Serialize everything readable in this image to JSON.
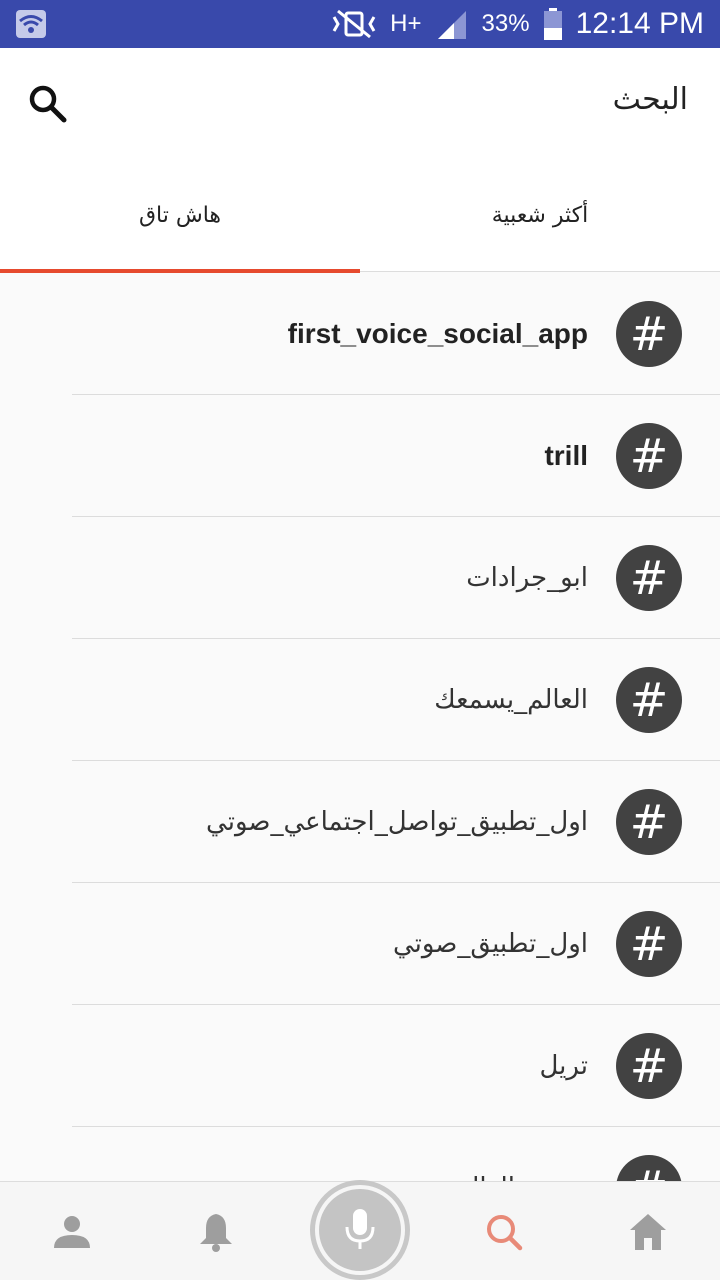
{
  "status_bar": {
    "network": "H+",
    "battery": "33%",
    "time": "12:14 PM"
  },
  "header": {
    "title": "البحث"
  },
  "tabs": [
    {
      "label": "أكثر شعبية",
      "active": false
    },
    {
      "label": "هاش تاق",
      "active": true
    }
  ],
  "hashtag_symbol": "#",
  "hashtags": [
    "first_voice_social_app",
    "trill",
    "ابو_جرادات",
    "العالم_يسمعك",
    "اول_تطبيق_تواصل_اجتماعي_صوتي",
    "اول_تطبيق_صوتي",
    "تريل",
    "صوت_العالم"
  ],
  "bottom_nav": {
    "items": [
      "profile-icon",
      "bell-icon",
      "mic-icon",
      "search-icon",
      "home-icon"
    ],
    "active": "search-icon"
  },
  "colors": {
    "status_bar": "#3949ab",
    "accent": "#e64a2e",
    "hash_circle": "#424242"
  }
}
